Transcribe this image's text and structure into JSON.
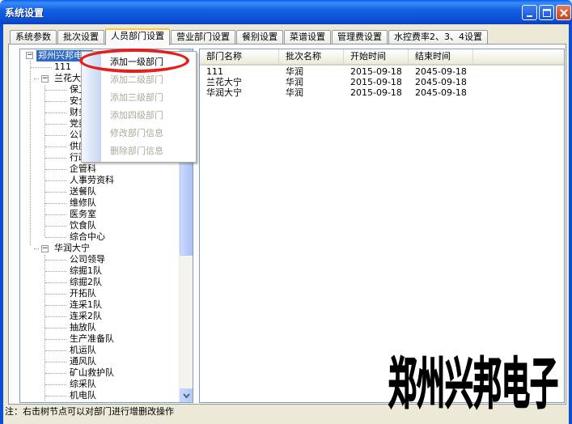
{
  "window": {
    "title": "系统设置"
  },
  "tabs": [
    {
      "label": "系统参数"
    },
    {
      "label": "批次设置"
    },
    {
      "label": "人员部门设置",
      "active": true
    },
    {
      "label": "营业部门设置"
    },
    {
      "label": "餐别设置"
    },
    {
      "label": "菜谱设置"
    },
    {
      "label": "管理费设置"
    },
    {
      "label": "水控费率2、3、4设置"
    }
  ],
  "tree": {
    "root": "郑州兴邦电子",
    "nodes": [
      {
        "label": "111",
        "level": 1
      },
      {
        "label": "兰花大宁",
        "level": 1,
        "expanded": true
      },
      {
        "label": "保卫处",
        "level": 2
      },
      {
        "label": "安全部",
        "level": 2
      },
      {
        "label": "财务部",
        "level": 2
      },
      {
        "label": "党委",
        "level": 2
      },
      {
        "label": "公司领导",
        "level": 2
      },
      {
        "label": "供应部",
        "level": 2
      },
      {
        "label": "行政部",
        "level": 2
      },
      {
        "label": "企管科",
        "level": 2
      },
      {
        "label": "人事劳资科",
        "level": 2
      },
      {
        "label": "送餐队",
        "level": 2
      },
      {
        "label": "维修队",
        "level": 2
      },
      {
        "label": "医务室",
        "level": 2
      },
      {
        "label": "饮食队",
        "level": 2
      },
      {
        "label": "综合中心",
        "level": 2
      },
      {
        "label": "华润大宁",
        "level": 1,
        "expanded": true
      },
      {
        "label": "公司领导",
        "level": 2
      },
      {
        "label": "综掘1队",
        "level": 2
      },
      {
        "label": "综掘2队",
        "level": 2
      },
      {
        "label": "开拓队",
        "level": 2
      },
      {
        "label": "连采1队",
        "level": 2
      },
      {
        "label": "连采2队",
        "level": 2
      },
      {
        "label": "抽放队",
        "level": 2
      },
      {
        "label": "生产准备队",
        "level": 2
      },
      {
        "label": "机运队",
        "level": 2
      },
      {
        "label": "通风队",
        "level": 2
      },
      {
        "label": "矿山救护队",
        "level": 2
      },
      {
        "label": "综采队",
        "level": 2
      },
      {
        "label": "机电队",
        "level": 2
      }
    ]
  },
  "context_menu": {
    "items": [
      {
        "label": "添加一级部门",
        "enabled": true
      },
      {
        "label": "添加二级部门",
        "enabled": false
      },
      {
        "label": "添加三级部门",
        "enabled": false
      },
      {
        "label": "添加四级部门",
        "enabled": false
      },
      {
        "label": "修改部门信息",
        "enabled": false
      },
      {
        "label": "删除部门信息",
        "enabled": false
      }
    ]
  },
  "table": {
    "columns": [
      "部门名称",
      "批次名称",
      "开始时间",
      "结束时间"
    ],
    "rows": [
      [
        "111",
        "华润",
        "2015-09-18",
        "2045-09-18"
      ],
      [
        "兰花大宁",
        "华润",
        "2015-09-18",
        "2045-09-18"
      ],
      [
        "华润大宁",
        "华润",
        "2015-09-18",
        "2045-09-18"
      ]
    ]
  },
  "status": {
    "text": "注：右击树节点可以对部门进行增删改操作"
  },
  "watermark": {
    "text": "郑州兴邦电子"
  },
  "colors": {
    "titlebar": "#0B4ED6",
    "selection": "#316AC5",
    "highlight_ring": "#E4201E",
    "disabled_text": "#ACA899"
  }
}
